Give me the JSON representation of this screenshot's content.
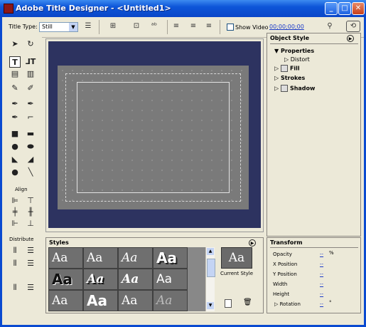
{
  "window": {
    "title": "Adobe Title Designer - <Untitled1>"
  },
  "toolbar": {
    "title_type_label": "Title Type:",
    "title_type_value": "Still",
    "show_video_label": "Show Video",
    "timecode": "00;00;00;00"
  },
  "tools": {
    "align_label": "Align",
    "distribute_label": "Distribute"
  },
  "object_style": {
    "header": "Object Style",
    "properties_label": "Properties",
    "distort_label": "Distort",
    "fill_label": "Fill",
    "strokes_label": "Strokes",
    "shadow_label": "Shadow"
  },
  "styles": {
    "header": "Styles",
    "current_style_label": "Current Style",
    "current_style_sample": "Aa",
    "samples": [
      "Aa",
      "Aa",
      "Aa",
      "Aa",
      "Aa",
      "Aa",
      "Aa",
      "Aa",
      "Aa",
      "Aa",
      "Aa",
      "Aa"
    ]
  },
  "transform": {
    "header": "Transform",
    "rows": [
      {
        "label": "Opacity",
        "value": "--",
        "unit": "%"
      },
      {
        "label": "X Position",
        "value": "--"
      },
      {
        "label": "Y Position",
        "value": "--"
      },
      {
        "label": "Width",
        "value": "--"
      },
      {
        "label": "Height",
        "value": "--"
      },
      {
        "label": "Rotation",
        "value": "--",
        "unit": "°"
      }
    ]
  },
  "colors": {
    "accent": "#0a46c8",
    "canvas_bg": "#2d3360"
  }
}
